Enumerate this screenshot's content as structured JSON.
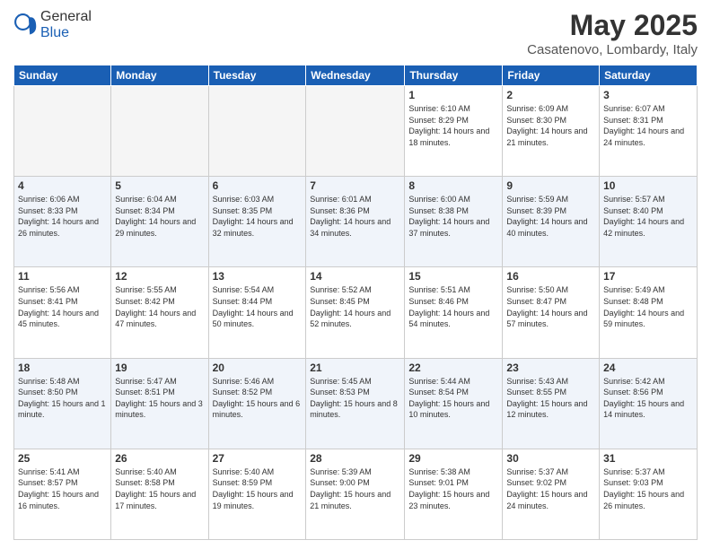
{
  "header": {
    "logo_general": "General",
    "logo_blue": "Blue",
    "month_year": "May 2025",
    "location": "Casatenovo, Lombardy, Italy"
  },
  "days_of_week": [
    "Sunday",
    "Monday",
    "Tuesday",
    "Wednesday",
    "Thursday",
    "Friday",
    "Saturday"
  ],
  "weeks": [
    [
      {
        "day": "",
        "empty": true
      },
      {
        "day": "",
        "empty": true
      },
      {
        "day": "",
        "empty": true
      },
      {
        "day": "",
        "empty": true
      },
      {
        "day": "1",
        "sunrise": "6:10 AM",
        "sunset": "8:29 PM",
        "daylight": "14 hours and 18 minutes."
      },
      {
        "day": "2",
        "sunrise": "6:09 AM",
        "sunset": "8:30 PM",
        "daylight": "14 hours and 21 minutes."
      },
      {
        "day": "3",
        "sunrise": "6:07 AM",
        "sunset": "8:31 PM",
        "daylight": "14 hours and 24 minutes."
      }
    ],
    [
      {
        "day": "4",
        "sunrise": "6:06 AM",
        "sunset": "8:33 PM",
        "daylight": "14 hours and 26 minutes."
      },
      {
        "day": "5",
        "sunrise": "6:04 AM",
        "sunset": "8:34 PM",
        "daylight": "14 hours and 29 minutes."
      },
      {
        "day": "6",
        "sunrise": "6:03 AM",
        "sunset": "8:35 PM",
        "daylight": "14 hours and 32 minutes."
      },
      {
        "day": "7",
        "sunrise": "6:01 AM",
        "sunset": "8:36 PM",
        "daylight": "14 hours and 34 minutes."
      },
      {
        "day": "8",
        "sunrise": "6:00 AM",
        "sunset": "8:38 PM",
        "daylight": "14 hours and 37 minutes."
      },
      {
        "day": "9",
        "sunrise": "5:59 AM",
        "sunset": "8:39 PM",
        "daylight": "14 hours and 40 minutes."
      },
      {
        "day": "10",
        "sunrise": "5:57 AM",
        "sunset": "8:40 PM",
        "daylight": "14 hours and 42 minutes."
      }
    ],
    [
      {
        "day": "11",
        "sunrise": "5:56 AM",
        "sunset": "8:41 PM",
        "daylight": "14 hours and 45 minutes."
      },
      {
        "day": "12",
        "sunrise": "5:55 AM",
        "sunset": "8:42 PM",
        "daylight": "14 hours and 47 minutes."
      },
      {
        "day": "13",
        "sunrise": "5:54 AM",
        "sunset": "8:44 PM",
        "daylight": "14 hours and 50 minutes."
      },
      {
        "day": "14",
        "sunrise": "5:52 AM",
        "sunset": "8:45 PM",
        "daylight": "14 hours and 52 minutes."
      },
      {
        "day": "15",
        "sunrise": "5:51 AM",
        "sunset": "8:46 PM",
        "daylight": "14 hours and 54 minutes."
      },
      {
        "day": "16",
        "sunrise": "5:50 AM",
        "sunset": "8:47 PM",
        "daylight": "14 hours and 57 minutes."
      },
      {
        "day": "17",
        "sunrise": "5:49 AM",
        "sunset": "8:48 PM",
        "daylight": "14 hours and 59 minutes."
      }
    ],
    [
      {
        "day": "18",
        "sunrise": "5:48 AM",
        "sunset": "8:50 PM",
        "daylight": "15 hours and 1 minute."
      },
      {
        "day": "19",
        "sunrise": "5:47 AM",
        "sunset": "8:51 PM",
        "daylight": "15 hours and 3 minutes."
      },
      {
        "day": "20",
        "sunrise": "5:46 AM",
        "sunset": "8:52 PM",
        "daylight": "15 hours and 6 minutes."
      },
      {
        "day": "21",
        "sunrise": "5:45 AM",
        "sunset": "8:53 PM",
        "daylight": "15 hours and 8 minutes."
      },
      {
        "day": "22",
        "sunrise": "5:44 AM",
        "sunset": "8:54 PM",
        "daylight": "15 hours and 10 minutes."
      },
      {
        "day": "23",
        "sunrise": "5:43 AM",
        "sunset": "8:55 PM",
        "daylight": "15 hours and 12 minutes."
      },
      {
        "day": "24",
        "sunrise": "5:42 AM",
        "sunset": "8:56 PM",
        "daylight": "15 hours and 14 minutes."
      }
    ],
    [
      {
        "day": "25",
        "sunrise": "5:41 AM",
        "sunset": "8:57 PM",
        "daylight": "15 hours and 16 minutes."
      },
      {
        "day": "26",
        "sunrise": "5:40 AM",
        "sunset": "8:58 PM",
        "daylight": "15 hours and 17 minutes."
      },
      {
        "day": "27",
        "sunrise": "5:40 AM",
        "sunset": "8:59 PM",
        "daylight": "15 hours and 19 minutes."
      },
      {
        "day": "28",
        "sunrise": "5:39 AM",
        "sunset": "9:00 PM",
        "daylight": "15 hours and 21 minutes."
      },
      {
        "day": "29",
        "sunrise": "5:38 AM",
        "sunset": "9:01 PM",
        "daylight": "15 hours and 23 minutes."
      },
      {
        "day": "30",
        "sunrise": "5:37 AM",
        "sunset": "9:02 PM",
        "daylight": "15 hours and 24 minutes."
      },
      {
        "day": "31",
        "sunrise": "5:37 AM",
        "sunset": "9:03 PM",
        "daylight": "15 hours and 26 minutes."
      }
    ]
  ]
}
